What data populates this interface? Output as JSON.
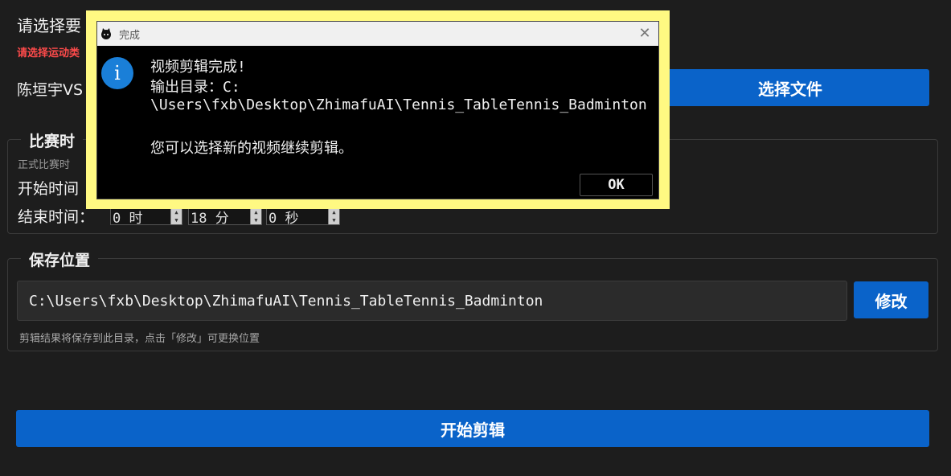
{
  "main": {
    "prompt_title": "请选择要",
    "prompt_warning": "请选择运动类",
    "file_name": "陈垣宇VS",
    "select_file_label": "选择文件",
    "time_group": {
      "title": "比赛时",
      "hint": "正式比赛时",
      "start_label": "开始时间",
      "end_label": "结束时间：",
      "end_hours": "0 时",
      "end_minutes": "18 分",
      "end_seconds": "0 秒"
    },
    "save_group": {
      "title": "保存位置",
      "path": "C:\\Users\\fxb\\Desktop\\ZhimafuAI\\Tennis_TableTennis_Badminton",
      "modify_label": "修改",
      "hint": "剪辑结果将保存到此目录，点击「修改」可更换位置"
    },
    "start_button_label": "开始剪辑"
  },
  "dialog": {
    "title": "完成",
    "message_line1": "视频剪辑完成!",
    "message_line2": "输出目录：C:",
    "message_line3": "\\Users\\fxb\\Desktop\\ZhimafuAI\\Tennis_TableTennis_Badminton",
    "message_line4": "您可以选择新的视频继续剪辑。",
    "ok_label": "OK",
    "info_icon_glyph": "i"
  },
  "colors": {
    "accent_blue": "#0a63c9",
    "warning_red": "#ff4b4b",
    "highlight_yellow": "#fff982",
    "background": "#1d1d1d"
  }
}
